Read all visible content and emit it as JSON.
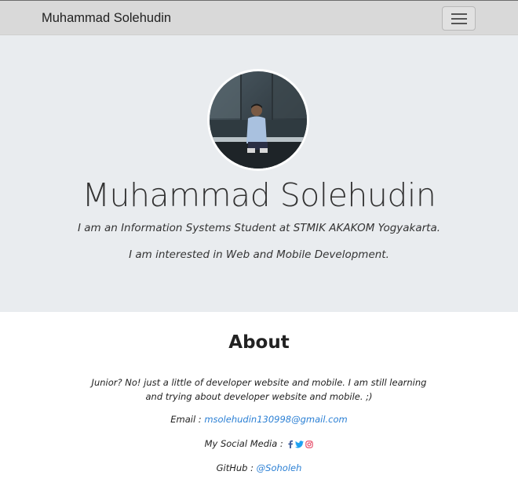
{
  "navbar": {
    "brand": "Muhammad Solehudin",
    "menu_icon": "hamburger-menu-icon"
  },
  "hero": {
    "avatar_icon": "profile-photo",
    "name": "Muhammad Solehudin",
    "line1": "I am an Information Systems Student at STMIK AKAKOM Yogyakarta.",
    "line2": "I am interested in Web and Mobile Development."
  },
  "about": {
    "title": "About",
    "text": "Junior? No! just a little of developer website and mobile. I am still learning and trying about developer website and mobile. ;)",
    "email_label": "Email : ",
    "email": "msolehudin130998@gmail.com",
    "social_label": "My Social Media : ",
    "social_icons": [
      "facebook-icon",
      "twitter-icon",
      "instagram-icon"
    ],
    "github_label": "GitHub : ",
    "github": "@Soholeh"
  },
  "colors": {
    "navbar_bg": "#d9d9d9",
    "hero_bg": "#e9ecef",
    "link": "#2a7fd4",
    "facebook": "#3b5998",
    "twitter": "#1da1f2",
    "instagram": "#e4405f"
  }
}
